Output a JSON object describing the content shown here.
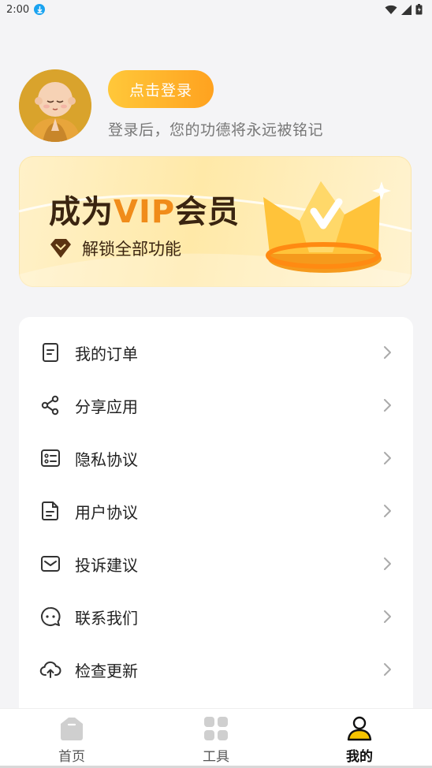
{
  "status_bar": {
    "time": "2:00"
  },
  "profile": {
    "login_button": "点击登录",
    "login_hint": "登录后，您的功德将永远被铭记"
  },
  "vip_banner": {
    "title_prefix": "成为",
    "title_vip": "VIP",
    "title_suffix": "会员",
    "subtitle": "解锁全部功能",
    "accent_color": "#f08c1a"
  },
  "menu": {
    "items": [
      {
        "label": "我的订单",
        "icon": "order-icon"
      },
      {
        "label": "分享应用",
        "icon": "share-icon"
      },
      {
        "label": "隐私协议",
        "icon": "privacy-icon"
      },
      {
        "label": "用户协议",
        "icon": "document-icon"
      },
      {
        "label": "投诉建议",
        "icon": "mail-icon"
      },
      {
        "label": "联系我们",
        "icon": "chat-icon"
      },
      {
        "label": "检查更新",
        "icon": "cloud-upload-icon"
      }
    ]
  },
  "tab_bar": {
    "tabs": [
      {
        "label": "首页",
        "icon": "home-icon",
        "active": false
      },
      {
        "label": "工具",
        "icon": "grid-icon",
        "active": false
      },
      {
        "label": "我的",
        "icon": "person-icon",
        "active": true
      }
    ],
    "active_color": "#f5c400"
  }
}
